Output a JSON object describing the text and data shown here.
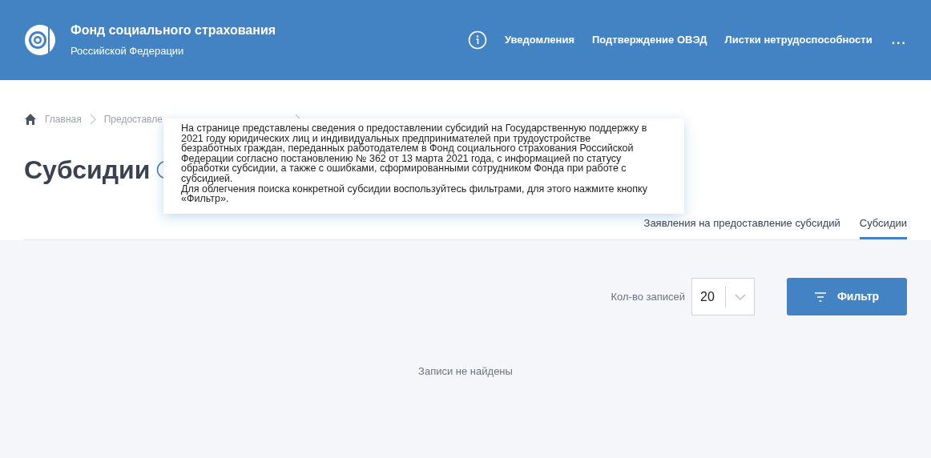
{
  "header": {
    "title": "Фонд социального страхования",
    "subtitle": "Российской Федерации",
    "nav": [
      "Уведомления",
      "Подтверждение ОВЭД",
      "Листки нетрудоспособности"
    ],
    "more": "..."
  },
  "breadcrumbs": [
    "Главная",
    "Предоставле"
  ],
  "page_title": "Субсидии",
  "tooltip": [
    "На странице представлены сведения о предоставлении субсидий на Государственную поддержку в 2021 году юридических лиц и индивидуальных предпринимателей при трудоустройстве безработных граждан, переданных работодателем в Фонд социального страхования Российской Федерации согласно постановлению № 362 от 13 марта 2021 года, с информацией по статусу обработки субсидии, а также с ошибками, сформированными сотрудником Фонда при работе с субсидией.",
    "Для облегчения поиска конкретной субсидии воспользуйтесь фильтрами, для этого нажмите кнопку «Фильтр»."
  ],
  "tabs": [
    {
      "label": "Заявления на предоставление субсидий",
      "selected": false
    },
    {
      "label": "Субсидии",
      "selected": true
    }
  ],
  "records": {
    "label": "Кол-во записей",
    "value": "20"
  },
  "filter_button": "Фильтр",
  "empty_message": "Записи не найдены"
}
